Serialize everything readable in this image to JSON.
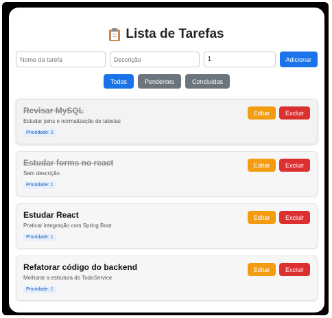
{
  "header": {
    "title": "Lista de Tarefas",
    "icon": "clipboard-icon"
  },
  "form": {
    "name_placeholder": "Nome da tarefa",
    "description_placeholder": "Descrição",
    "priority_value": "1",
    "add_label": "Adicionar"
  },
  "filters": {
    "all": "Todas",
    "pending": "Pendentes",
    "completed": "Concluídas",
    "active": "all"
  },
  "tasks": [
    {
      "title": "Revisar MySQL",
      "description": "Estudar joins e normalização de tabelas",
      "priority": "Prioridade: 2",
      "done": true,
      "edit_label": "Editar",
      "delete_label": "Excluir"
    },
    {
      "title": "Estudar forms no react",
      "description": "Sem descrição",
      "priority": "Prioridade: 1",
      "done": true,
      "edit_label": "Editar",
      "delete_label": "Excluir"
    },
    {
      "title": "Estudar React",
      "description": "Praticar integração com Spring Boot",
      "priority": "Prioridade: 1",
      "done": false,
      "edit_label": "Editar",
      "delete_label": "Excluir"
    },
    {
      "title": "Refatorar código do backend",
      "description": "Melhorar a estrutura do TodoService",
      "priority": "Prioridade: 1",
      "done": false,
      "edit_label": "Editar",
      "delete_label": "Excluir"
    }
  ],
  "colors": {
    "primary": "#1a73e8",
    "secondary": "#6c757d",
    "edit": "#f39c12",
    "delete": "#dc2f2f"
  }
}
